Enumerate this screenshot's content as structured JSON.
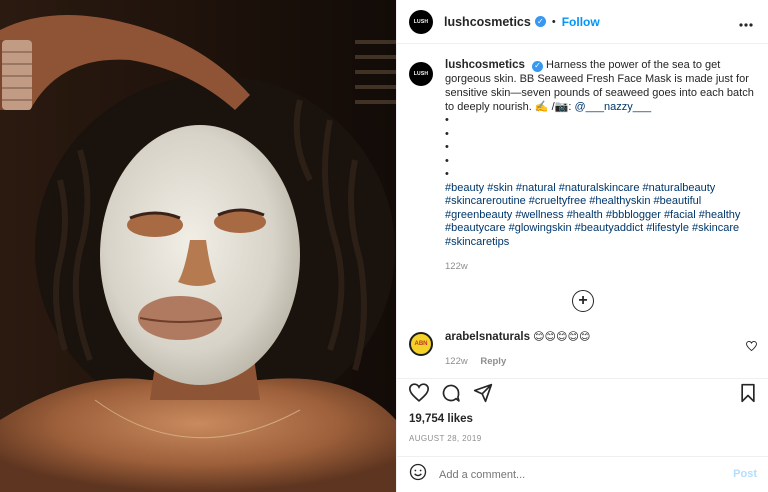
{
  "header": {
    "avatar_text": "LUSH",
    "username": "lushcosmetics",
    "separator": "•",
    "follow_label": "Follow",
    "more_icon": "more-horizontal-icon"
  },
  "caption": {
    "avatar_text": "LUSH",
    "username": "lushcosmetics",
    "text": "Harness the power of the sea to get gorgeous skin. BB Seaweed Fresh Face Mask is made just for sensitive skin—seven pounds of seaweed goes into each batch to deeply nourish. ✍️ /📷: ",
    "mention": "@___nazzy___",
    "bullets": [
      "•",
      "•",
      "•",
      "•",
      "•"
    ],
    "hashtags": "#beauty #skin #natural #naturalskincare #naturalbeauty #skincareroutine #crueltyfree #healthyskin #beautiful #greenbeauty #wellness #health #bbblogger #facial #healthy #beautycare #glowingskin #beautyaddict #lifestyle #skincare #skincaretips",
    "time": "122w"
  },
  "load_more_icon": "plus-circle-icon",
  "comment": {
    "avatar_text": "ABN",
    "username": "arabelsnaturals",
    "text": "😊😊😊😊😊",
    "time": "122w",
    "reply_label": "Reply"
  },
  "post_meta": {
    "likes": "19,754 likes",
    "date": "AUGUST 28, 2019"
  },
  "add_comment": {
    "placeholder": "Add a comment...",
    "post_label": "Post"
  },
  "colors": {
    "link": "#00376b",
    "follow": "#0095f6",
    "muted": "#8e8e8e",
    "verified": "#3897f0"
  }
}
